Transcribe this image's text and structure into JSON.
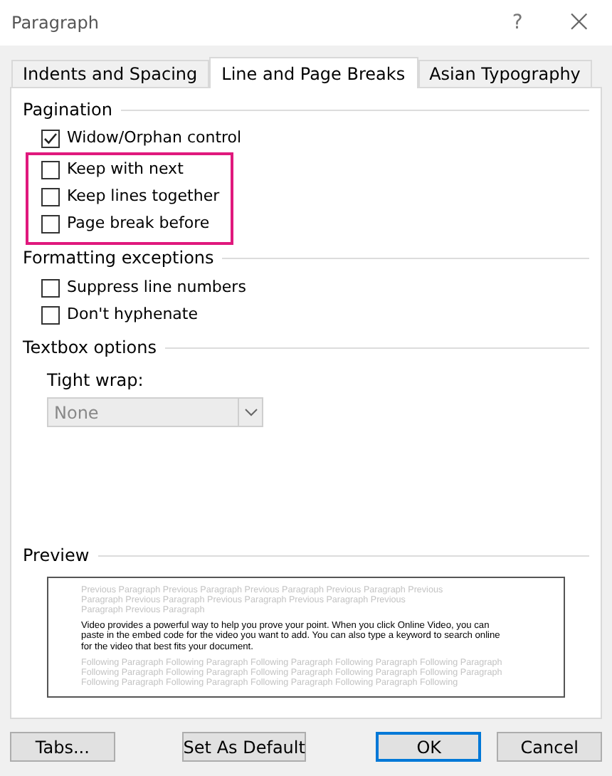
{
  "window": {
    "title": "Paragraph",
    "help": "?",
    "close": "×"
  },
  "tabs": [
    {
      "label": "Indents and Spacing",
      "selected": false
    },
    {
      "label": "Line and Page Breaks",
      "selected": true
    },
    {
      "label": "Asian Typography",
      "selected": false
    }
  ],
  "pagination": {
    "title": "Pagination",
    "options": [
      {
        "label": "Widow/Orphan control",
        "checked": true,
        "highlighted": false
      },
      {
        "label": "Keep with next",
        "checked": false,
        "highlighted": true
      },
      {
        "label": "Keep lines together",
        "checked": false,
        "highlighted": true
      },
      {
        "label": "Page break before",
        "checked": false,
        "highlighted": true
      }
    ]
  },
  "formatting_exceptions": {
    "title": "Formatting exceptions",
    "options": [
      {
        "label": "Suppress line numbers",
        "checked": false,
        "highlighted": false
      },
      {
        "label": "Don't hyphenate",
        "checked": false,
        "highlighted": false
      }
    ]
  },
  "textbox_options": {
    "title": "Textbox options",
    "tight_wrap": {
      "label": "Tight wrap:",
      "value": "None",
      "disabled": true
    }
  },
  "preview": {
    "title": "Preview",
    "previous": "Previous Paragraph Previous Paragraph Previous Paragraph Previous Paragraph Previous Paragraph Previous Paragraph Previous Paragraph Previous Paragraph Previous Paragraph Previous Paragraph",
    "current": "Video provides a powerful way to help you prove your point. When you click Online Video, you can paste in the embed code for the video you want to add. You can also type a keyword to search online for the video that best fits your document.",
    "following": "Following Paragraph Following Paragraph Following Paragraph Following Paragraph Following Paragraph Following Paragraph Following Paragraph Following Paragraph Following Paragraph Following Paragraph Following Paragraph Following Paragraph Following Paragraph Following Paragraph Following"
  },
  "buttons": [
    {
      "label": "Tabs...",
      "kind": "normal"
    },
    {
      "label": "Set As Default",
      "kind": "normal"
    },
    {
      "label": "OK",
      "kind": "default"
    },
    {
      "label": "Cancel",
      "kind": "normal"
    }
  ]
}
